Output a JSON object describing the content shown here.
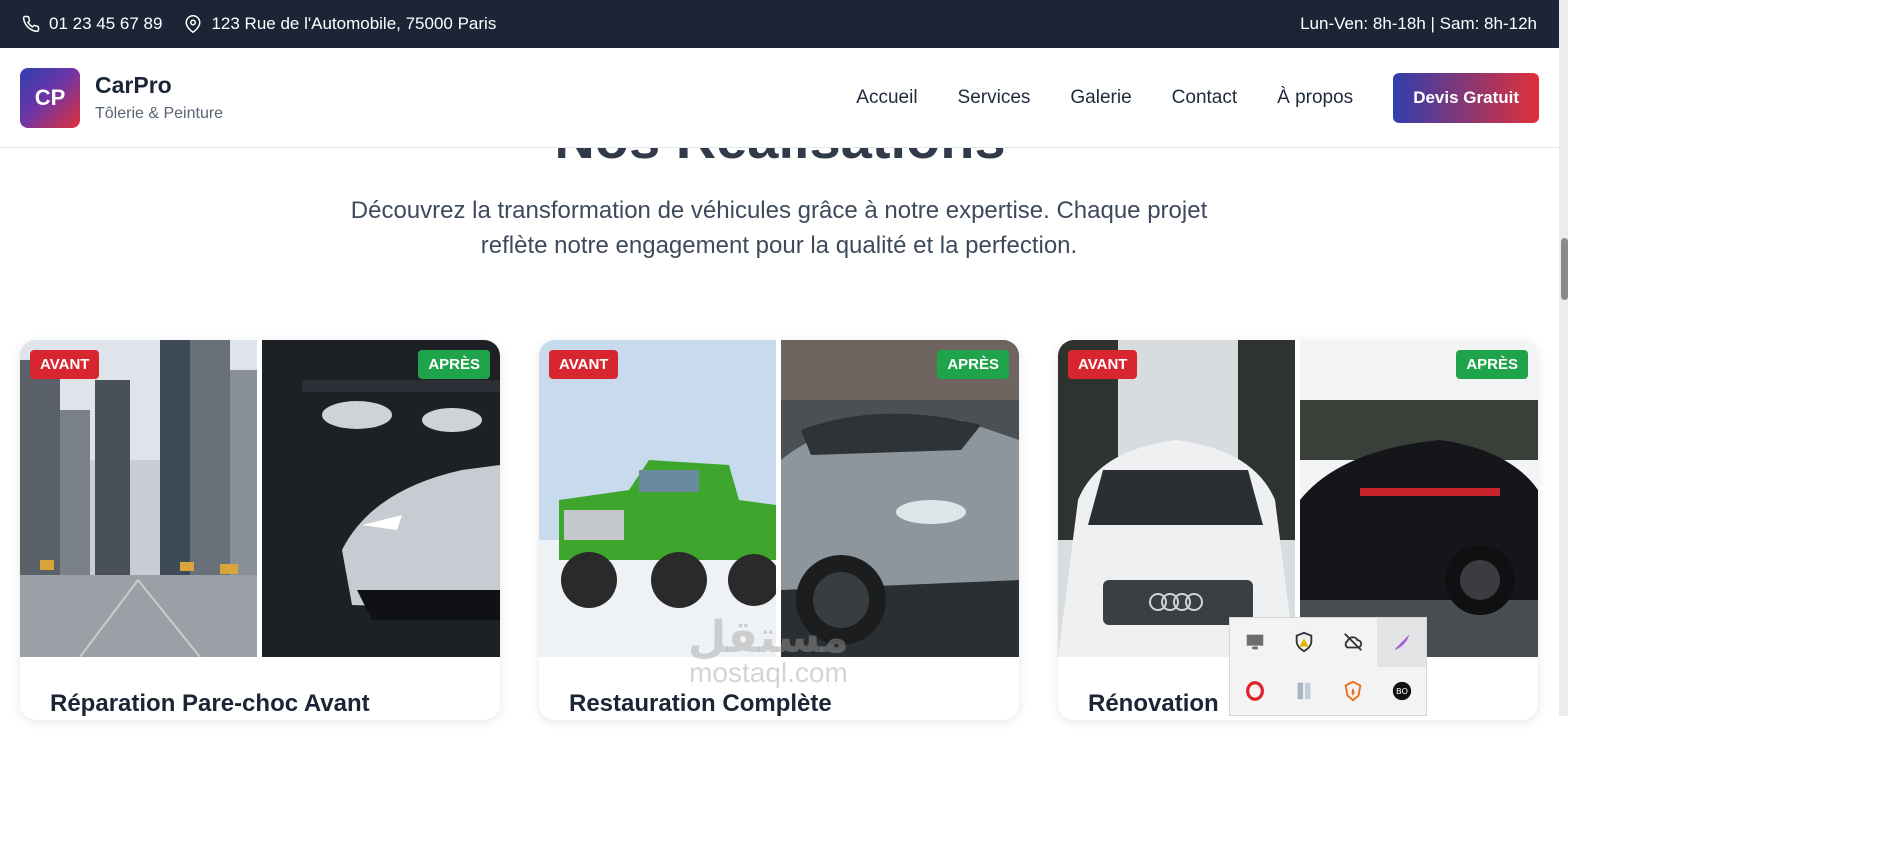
{
  "topbar": {
    "phone": "01 23 45 67 89",
    "address": "123 Rue de l'Automobile, 75000 Paris",
    "hours": "Lun-Ven: 8h-18h | Sam: 8h-12h"
  },
  "brand": {
    "initials": "CP",
    "name": "CarPro",
    "tagline": "Tôlerie & Peinture"
  },
  "nav": {
    "items": [
      "Accueil",
      "Services",
      "Galerie",
      "Contact",
      "À propos"
    ],
    "cta": "Devis Gratuit"
  },
  "section": {
    "title": "Nos Réalisations",
    "intro_line1": "Découvrez la transformation de véhicules grâce à notre expertise. Chaque projet",
    "intro_line2": "reflète notre engagement pour la qualité et la perfection."
  },
  "badges": {
    "before": "AVANT",
    "after": "APRÈS"
  },
  "cards": [
    {
      "title": "Réparation Pare-choc Avant"
    },
    {
      "title": "Restauration Complète"
    },
    {
      "title": "Rénovation"
    }
  ],
  "watermark": {
    "arabic": "مستقل",
    "latin": "mostaql.com"
  },
  "tray_icons": [
    "monitor-icon",
    "shield-warning-icon",
    "cloud-off-icon",
    "feather-icon",
    "opera-icon",
    "server-icon",
    "brave-icon",
    "bo-icon"
  ],
  "colors": {
    "topbar": "#1b2536",
    "before_badge": "#d7262f",
    "after_badge": "#1fa34b",
    "cta_start": "#2f3fae",
    "cta_end": "#e0303a"
  }
}
